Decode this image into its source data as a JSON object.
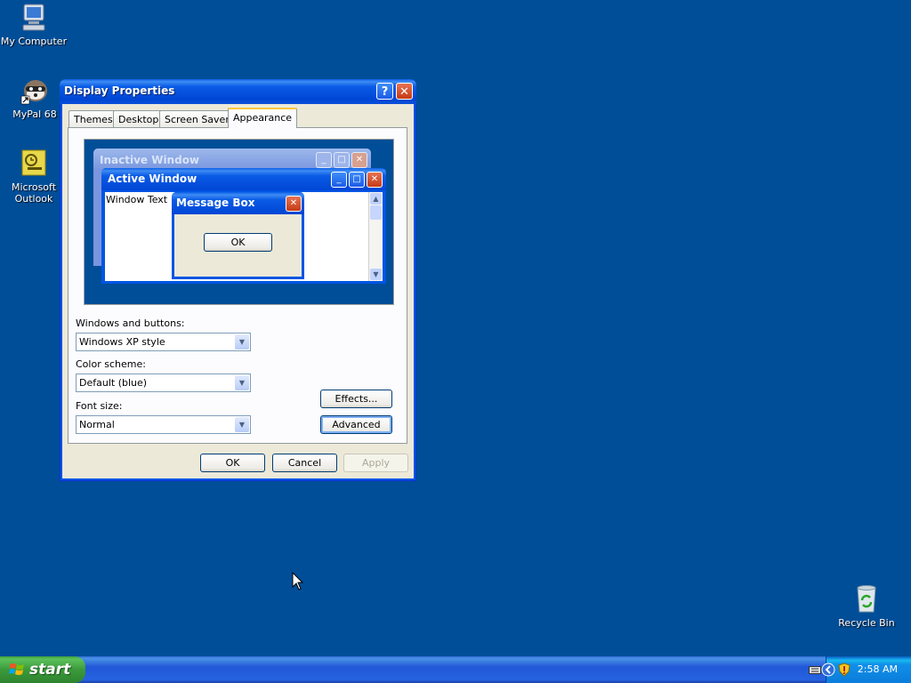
{
  "desktop": {
    "icons": [
      {
        "label": "My Computer",
        "icon": "my-computer-icon"
      },
      {
        "label": "MyPal 68",
        "icon": "mypal-browser-icon"
      },
      {
        "label": "Microsoft Outlook",
        "icon": "outlook-icon"
      },
      {
        "label": "Recycle Bin",
        "icon": "recycle-bin-icon"
      }
    ],
    "background_color": "#004e98"
  },
  "dialog": {
    "title": "Display Properties",
    "help_label": "?",
    "close_label": "✕",
    "tabs": [
      {
        "label": "Themes"
      },
      {
        "label": "Desktop"
      },
      {
        "label": "Screen Saver"
      },
      {
        "label": "Appearance",
        "active": true
      }
    ],
    "preview": {
      "inactive_title": "Inactive Window",
      "active_title": "Active Window",
      "window_text": "Window Text",
      "message_box_title": "Message Box",
      "message_box_ok": "OK"
    },
    "windows_buttons": {
      "label": "Windows and buttons:",
      "value": "Windows XP style"
    },
    "color_scheme": {
      "label": "Color scheme:",
      "value": "Default (blue)"
    },
    "font_size": {
      "label": "Font size:",
      "value": "Normal"
    },
    "effects_label": "Effects...",
    "advanced_label": "Advanced",
    "ok_label": "OK",
    "cancel_label": "Cancel",
    "apply_label": "Apply"
  },
  "taskbar": {
    "start_label": "start",
    "clock": "2:58 AM"
  }
}
